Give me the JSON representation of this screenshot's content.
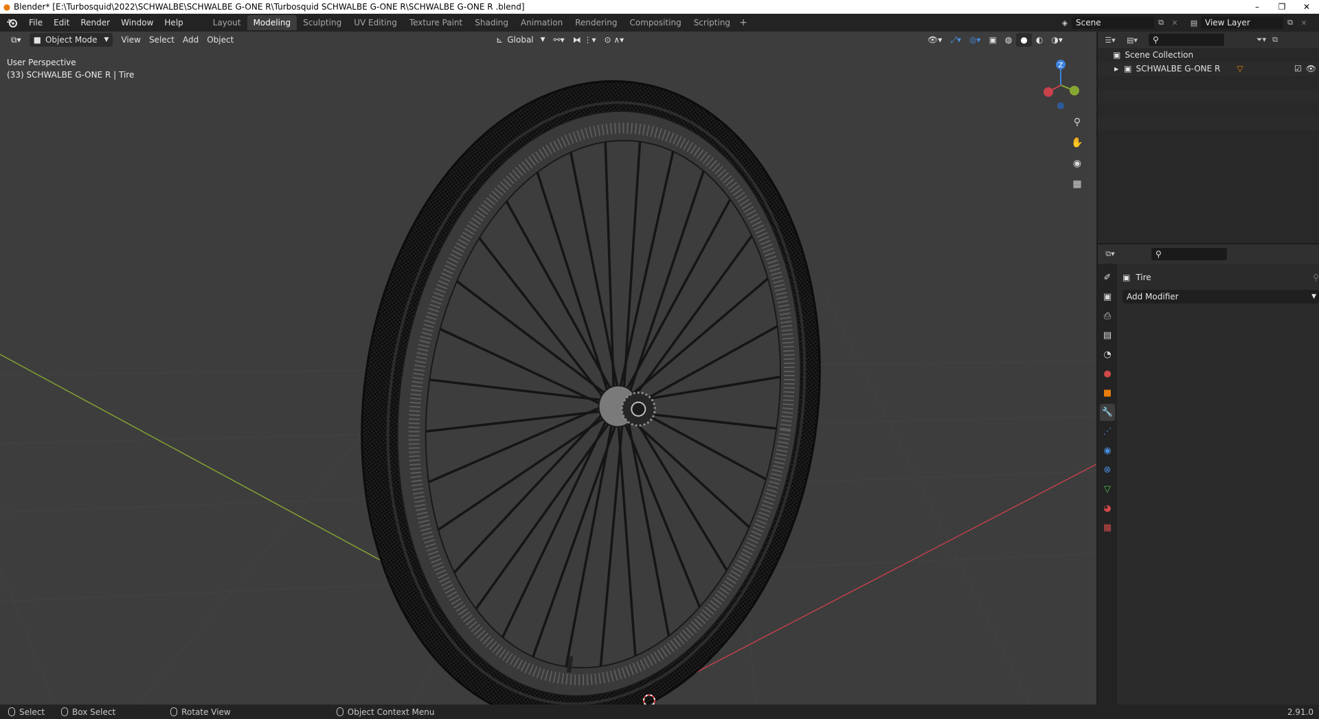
{
  "window": {
    "title": "Blender* [E:\\Turbosquid\\2022\\SCHWALBE\\SCHWALBE G-ONE R\\Turbosquid SCHWALBE G-ONE R\\SCHWALBE G-ONE R .blend]",
    "minimize": "–",
    "restore": "❐",
    "close": "✕"
  },
  "menu": {
    "items": [
      "File",
      "Edit",
      "Render",
      "Window",
      "Help"
    ]
  },
  "workspaces": {
    "tabs": [
      "Layout",
      "Modeling",
      "Sculpting",
      "UV Editing",
      "Texture Paint",
      "Shading",
      "Animation",
      "Rendering",
      "Compositing",
      "Scripting"
    ],
    "active_index": 1,
    "add": "+"
  },
  "scene": {
    "name": "Scene",
    "view_layer": "View Layer"
  },
  "viewport_header": {
    "mode": "Object Mode",
    "view": "View",
    "select": "Select",
    "add": "Add",
    "object": "Object",
    "orientation": "Global"
  },
  "viewport": {
    "perspective": "User Perspective",
    "object_info": "(33)  SCHWALBE G-ONE R | Tire",
    "gizmo_axis_label": "Z",
    "axis_colors": {
      "x": "#c8414b",
      "y": "#86a832",
      "z": "#3d82dc"
    },
    "background": "#3d3d3d"
  },
  "outliner": {
    "collection": "Scene Collection",
    "item": "SCHWALBE G-ONE R"
  },
  "properties": {
    "object_name": "Tire",
    "add_modifier": "Add Modifier"
  },
  "statusbar": {
    "select": "Select",
    "box_select": "Box Select",
    "rotate_view": "Rotate View",
    "context_menu": "Object Context Menu",
    "version": "2.91.0"
  },
  "accent": "#e87d0d"
}
